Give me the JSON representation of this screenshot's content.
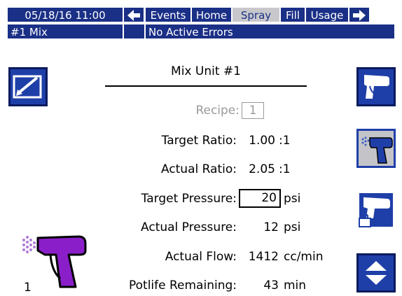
{
  "nav": {
    "datetime": "05/18/16 11:00",
    "tabs": [
      {
        "label": "Events"
      },
      {
        "label": "Home"
      },
      {
        "label": "Spray"
      },
      {
        "label": "Fill"
      },
      {
        "label": "Usage"
      }
    ],
    "active_tab": "Spray"
  },
  "status": {
    "mix": "#1 Mix",
    "errors": "No Active Errors"
  },
  "main": {
    "title": "Mix Unit #1",
    "recipe_label": "Recipe:",
    "recipe_value": "1",
    "fields": [
      {
        "label": "Target Ratio:",
        "value": "1.00",
        "unit": ":1"
      },
      {
        "label": "Actual Ratio:",
        "value": "2.05",
        "unit": ":1"
      },
      {
        "label": "Target Pressure:",
        "value": "20",
        "unit": "psi"
      },
      {
        "label": "Actual Pressure:",
        "value": "12",
        "unit": "psi"
      },
      {
        "label": "Actual Flow:",
        "value": "1412",
        "unit": "cc/min"
      },
      {
        "label": "Potlife Remaining:",
        "value": "43",
        "unit": "min"
      }
    ],
    "gun_number": "1"
  },
  "colors": {
    "nav_blue": "#1a2f86",
    "button_blue": "#1f3fa8",
    "gun_purple": "#8a1fc9",
    "inactive_grey": "#9a9a9a"
  },
  "icons": {
    "edit": "edit-icon",
    "back": "arrow-left-icon",
    "next": "arrow-right-icon",
    "spray_gun": "spray-gun-icon",
    "flush_gun": "flush-gun-icon",
    "gun_trigger": "gun-trigger-icon",
    "gun_lock": "gun-lock-icon",
    "up_down": "up-down-arrows-icon"
  }
}
